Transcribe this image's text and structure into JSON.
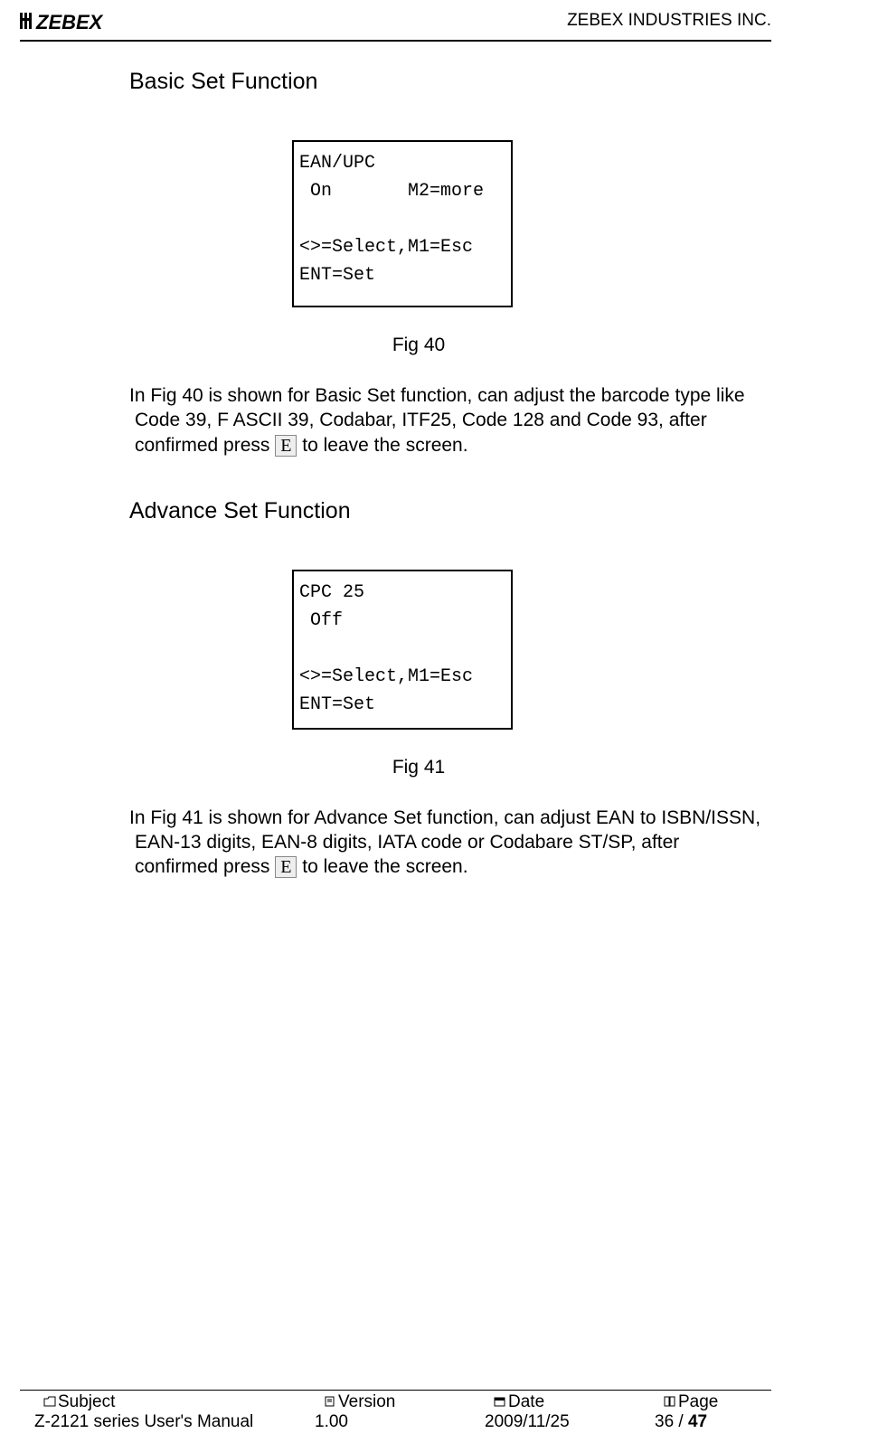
{
  "header": {
    "company": "ZEBEX INDUSTRIES INC.",
    "logo_text": "ZEBEX"
  },
  "sections": {
    "basic": {
      "title": "Basic Set Function",
      "lcd": {
        "line1": "EAN/UPC",
        "line2": " On       M2=more",
        "line3": "",
        "line4": "<>=Select,M1=Esc",
        "line5": "ENT=Set"
      },
      "figcap": "Fig 40",
      "para_a": "In Fig 40 is shown for Basic Set function, can adjust the barcode type like",
      "para_b": "Code 39, F ASCII 39, Codabar, ITF25, Code 128 and Code 93, after",
      "para_c1": "confirmed press ",
      "key": "E",
      "para_c2": " to leave the screen."
    },
    "advance": {
      "title": "Advance Set Function",
      "lcd": {
        "line1": "CPC 25",
        "line2": " Off",
        "line3": "",
        "line4": "<>=Select,M1=Esc",
        "line5": "ENT=Set"
      },
      "figcap": "Fig 41",
      "para_a": "In Fig 41 is shown for Advance Set function, can adjust EAN to ISBN/ISSN,",
      "para_b": "EAN-13 digits, EAN-8 digits, IATA code or Codabare ST/SP, after",
      "para_c1": "confirmed press ",
      "key": "E",
      "para_c2": " to leave the screen."
    }
  },
  "footer": {
    "labels": {
      "subject": "Subject",
      "version": "Version",
      "date": "Date",
      "page": "Page"
    },
    "values": {
      "subject": "Z-2121 series User's Manual",
      "version": "1.00",
      "date": "2009/11/25",
      "page_cur": "36",
      "page_sep": " / ",
      "page_total": "47"
    }
  }
}
